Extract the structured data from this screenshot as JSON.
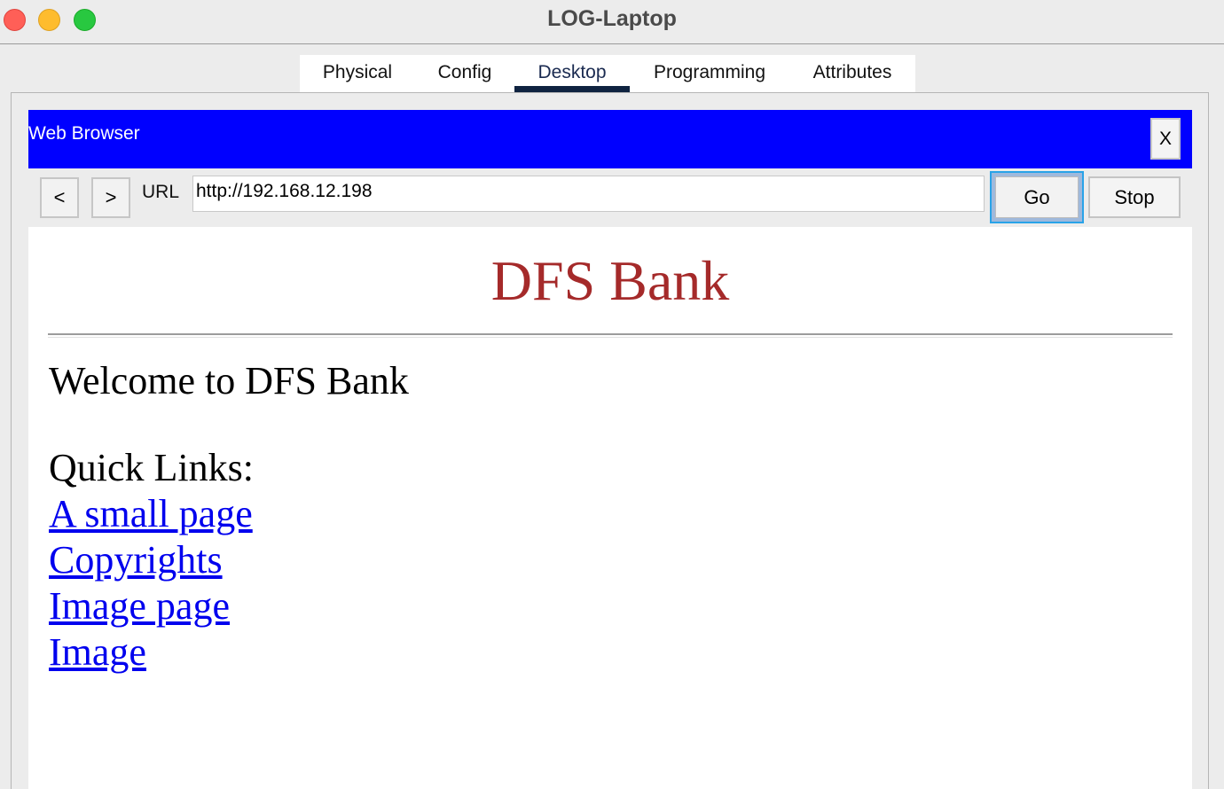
{
  "window": {
    "title": "LOG-Laptop"
  },
  "tabs": [
    {
      "label": "Physical"
    },
    {
      "label": "Config"
    },
    {
      "label": "Desktop"
    },
    {
      "label": "Programming"
    },
    {
      "label": "Attributes"
    }
  ],
  "active_tab": "Desktop",
  "app": {
    "title": "Web Browser",
    "close_label": "X",
    "back_label": "<",
    "forward_label": ">",
    "url_label": "URL",
    "url_value": "http://192.168.12.198",
    "go_label": "Go",
    "stop_label": "Stop"
  },
  "page": {
    "title": "DFS Bank",
    "welcome": "Welcome to DFS Bank",
    "quick_links_heading": "Quick Links:",
    "links": [
      {
        "label": "A small page"
      },
      {
        "label": "Copyrights"
      },
      {
        "label": "Image page"
      },
      {
        "label": "Image"
      }
    ]
  },
  "colors": {
    "app_bar": "#0000ff",
    "bank_title": "#a52a2a",
    "link": "#0000ee",
    "active_tab_indicator": "#0f2340",
    "focus_ring": "#29a3e8"
  },
  "icons": {
    "close": "close-icon",
    "minimize": "minimize-icon",
    "maximize": "maximize-icon"
  }
}
